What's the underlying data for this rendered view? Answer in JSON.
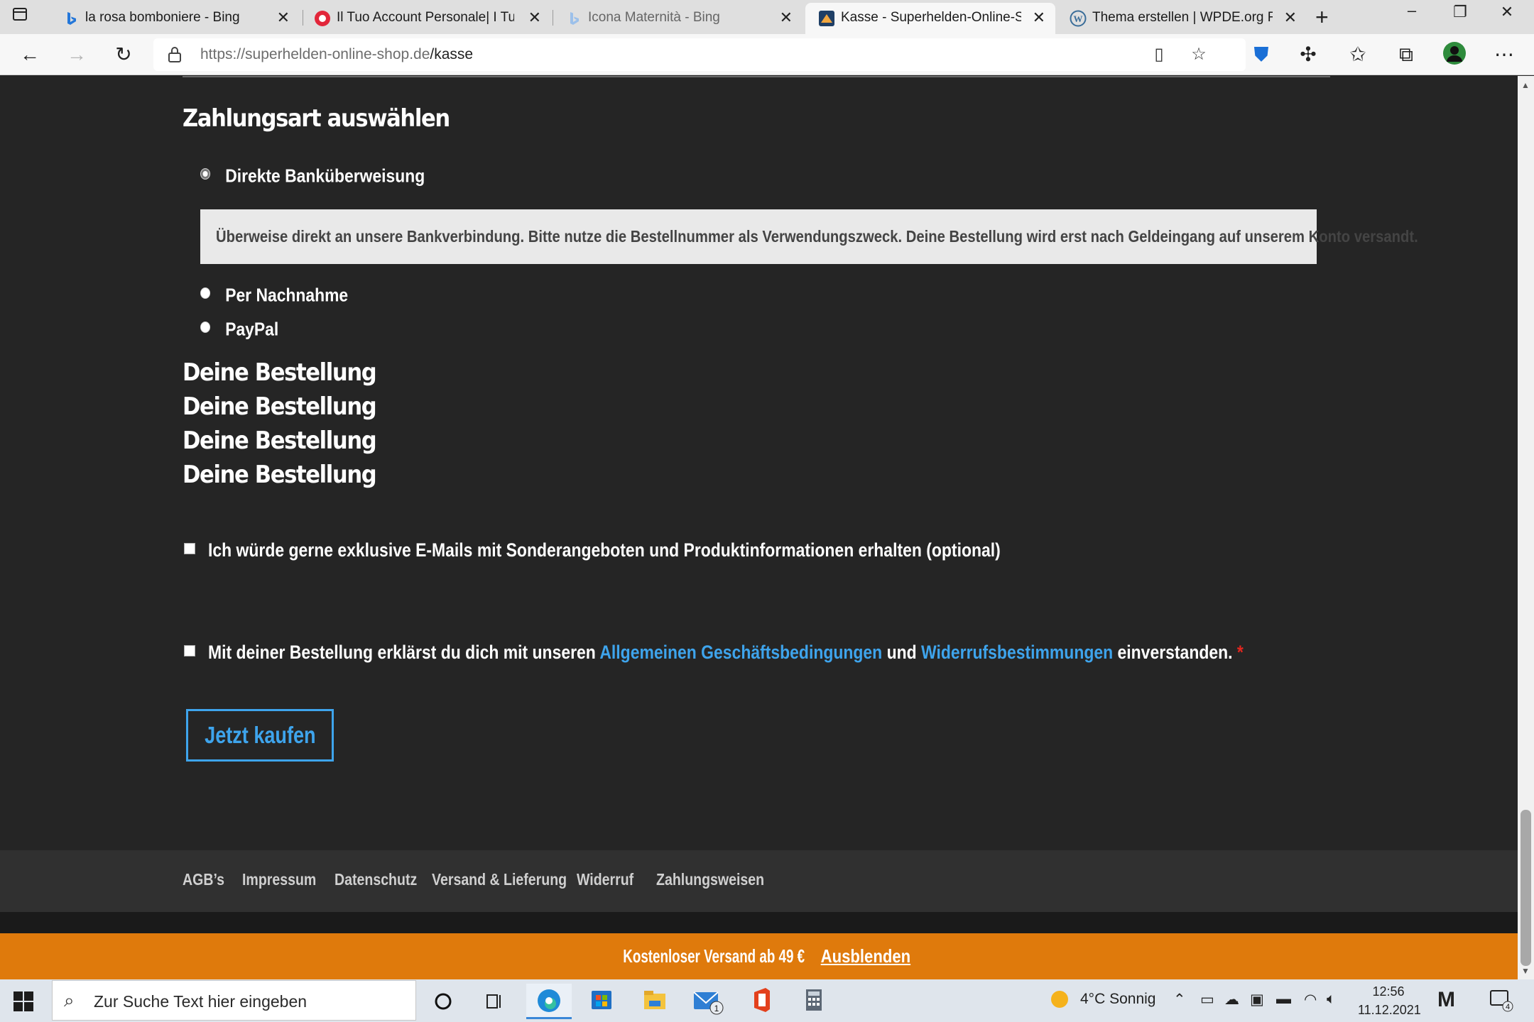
{
  "browser": {
    "tabs": [
      {
        "title": "la rosa bomboniere - Bing",
        "icon": "bing-icon"
      },
      {
        "title": "Il Tuo Account Personale| I Tuoi",
        "icon": "account-icon"
      },
      {
        "title": "Icona Maternità - Bing",
        "icon": "bing-icon"
      },
      {
        "title": "Kasse - Superhelden-Online-Sho",
        "icon": "shop-icon",
        "active": true
      },
      {
        "title": "Thema erstellen | WPDE.org Fon",
        "icon": "wordpress-icon"
      }
    ],
    "url_host": "https://superhelden-online-shop.de",
    "url_path": "/kasse"
  },
  "checkout": {
    "payment_heading": "Zahlungsart auswählen",
    "payment_methods": [
      {
        "label": "Direkte Banküberweisung",
        "selected": true
      },
      {
        "label": "Per Nachnahme",
        "selected": false
      },
      {
        "label": "PayPal",
        "selected": false
      }
    ],
    "bank_transfer_note": "Überweise direkt an unsere Bankverbindung. Bitte nutze die Bestellnummer als Verwendungszweck. Deine Bestellung wird erst nach Geldeingang auf unserem Konto versandt.",
    "order_headings": [
      "Deine Bestellung",
      "Deine Bestellung",
      "Deine Bestellung",
      "Deine Bestellung"
    ],
    "newsletter_label": "Ich würde gerne exklusive E-Mails mit Sonderangeboten und Produktinformationen erhalten (optional)",
    "terms_prefix": "Mit deiner Bestellung erklärst du dich mit unseren ",
    "terms_link": "Allgemeinen Geschäftsbedingungen",
    "terms_and": " und ",
    "withdrawal_link": "Widerrufsbestimmungen",
    "terms_suffix": " einverstanden.",
    "required_mark": "*",
    "buy_button": "Jetzt kaufen"
  },
  "footer": {
    "links": [
      "AGB’s",
      "Impressum",
      "Datenschutz",
      "Versand & Lieferung",
      "Widerruf",
      "Zahlungsweisen"
    ]
  },
  "notice": {
    "text": "Kostenloser Versand ab 49 € ",
    "dismiss": "Ausblenden"
  },
  "taskbar": {
    "search_placeholder": "Zur Suche Text hier eingeben",
    "weather": "4°C  Sonnig",
    "time": "12:56",
    "date": "11.12.2021",
    "mail_badge": "1",
    "notification_count": "4"
  },
  "colors": {
    "page_bg": "#252525",
    "accent_blue": "#3ea4ec",
    "notice_orange": "#df7a0c",
    "required_red": "#e2261f"
  }
}
